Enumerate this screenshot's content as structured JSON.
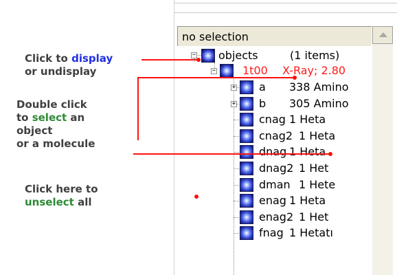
{
  "annotations": {
    "display": {
      "line1_pre": "Click to ",
      "line1_hl": "display",
      "line2": "or undisplay"
    },
    "select": {
      "line1": "Double click",
      "line2_pre": "to ",
      "line2_hl": "select",
      "line2_post": " an",
      "line3": "object",
      "line4": "or a molecule"
    },
    "unselect": {
      "line1": "Click here to",
      "line2_hl": "unselect",
      "line2_post": " all"
    }
  },
  "panel": {
    "selection_label": "no selection",
    "tree": {
      "root": {
        "name": "objects",
        "info": "(1 items)"
      },
      "object": {
        "name": "1t00",
        "info": "X-Ray; 2.80"
      },
      "children": [
        {
          "name": "a",
          "info": "338 Amino",
          "expander": "+"
        },
        {
          "name": "b",
          "info": "305 Amino",
          "expander": "+"
        },
        {
          "name": "cnag",
          "info": "1 Heta"
        },
        {
          "name": "cnag2",
          "info": "1 Heta"
        },
        {
          "name": "dnag",
          "info": "1 Heta"
        },
        {
          "name": "dnag2",
          "info": "1 Het"
        },
        {
          "name": "dman",
          "info": "1 Hete"
        },
        {
          "name": "enag",
          "info": "1 Heta"
        },
        {
          "name": "enag2",
          "info": "1 Het"
        },
        {
          "name": "fnag",
          "info": "1 Hetatı"
        }
      ]
    }
  },
  "colors": {
    "pointer": "#ff0f0f",
    "highlight_blue": "#1f2ee6",
    "highlight_green": "#2e8a36"
  }
}
